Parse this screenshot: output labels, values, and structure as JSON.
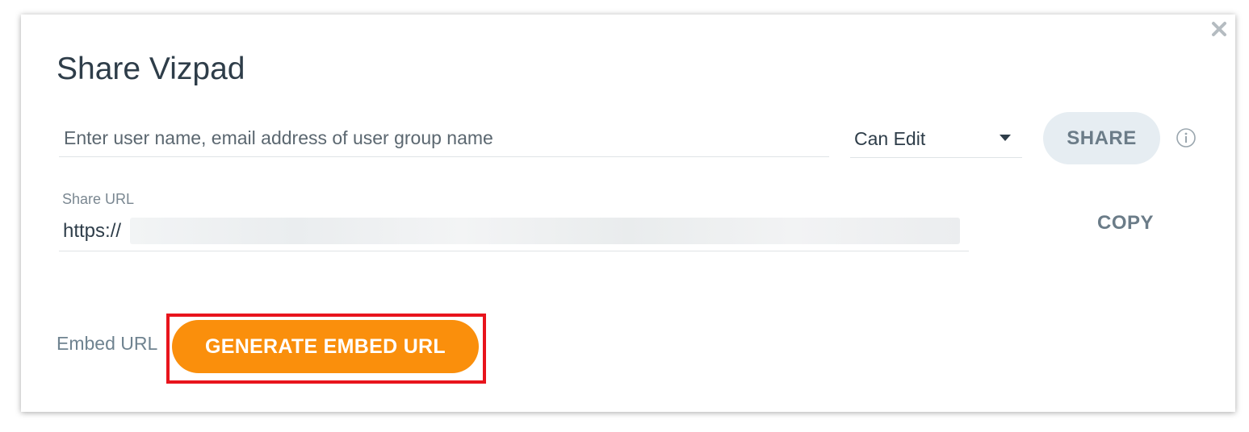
{
  "dialog": {
    "title": "Share Vizpad",
    "close_icon": "close-icon"
  },
  "share_user": {
    "input_placeholder": "Enter user name, email address of user group name",
    "input_value": "",
    "permission_selected": "Can Edit",
    "share_label": "SHARE",
    "info_icon": "info-icon"
  },
  "share_url": {
    "label": "Share URL",
    "prefix": "https://",
    "copy_label": "COPY"
  },
  "embed": {
    "label": "Embed URL",
    "generate_label": "GENERATE EMBED URL"
  },
  "colors": {
    "accent_orange": "#fa8f0c",
    "highlight_red": "#e8141c",
    "share_button_bg": "#e6edf2",
    "text_dark": "#2e3d49",
    "text_muted": "#6b7c88"
  }
}
